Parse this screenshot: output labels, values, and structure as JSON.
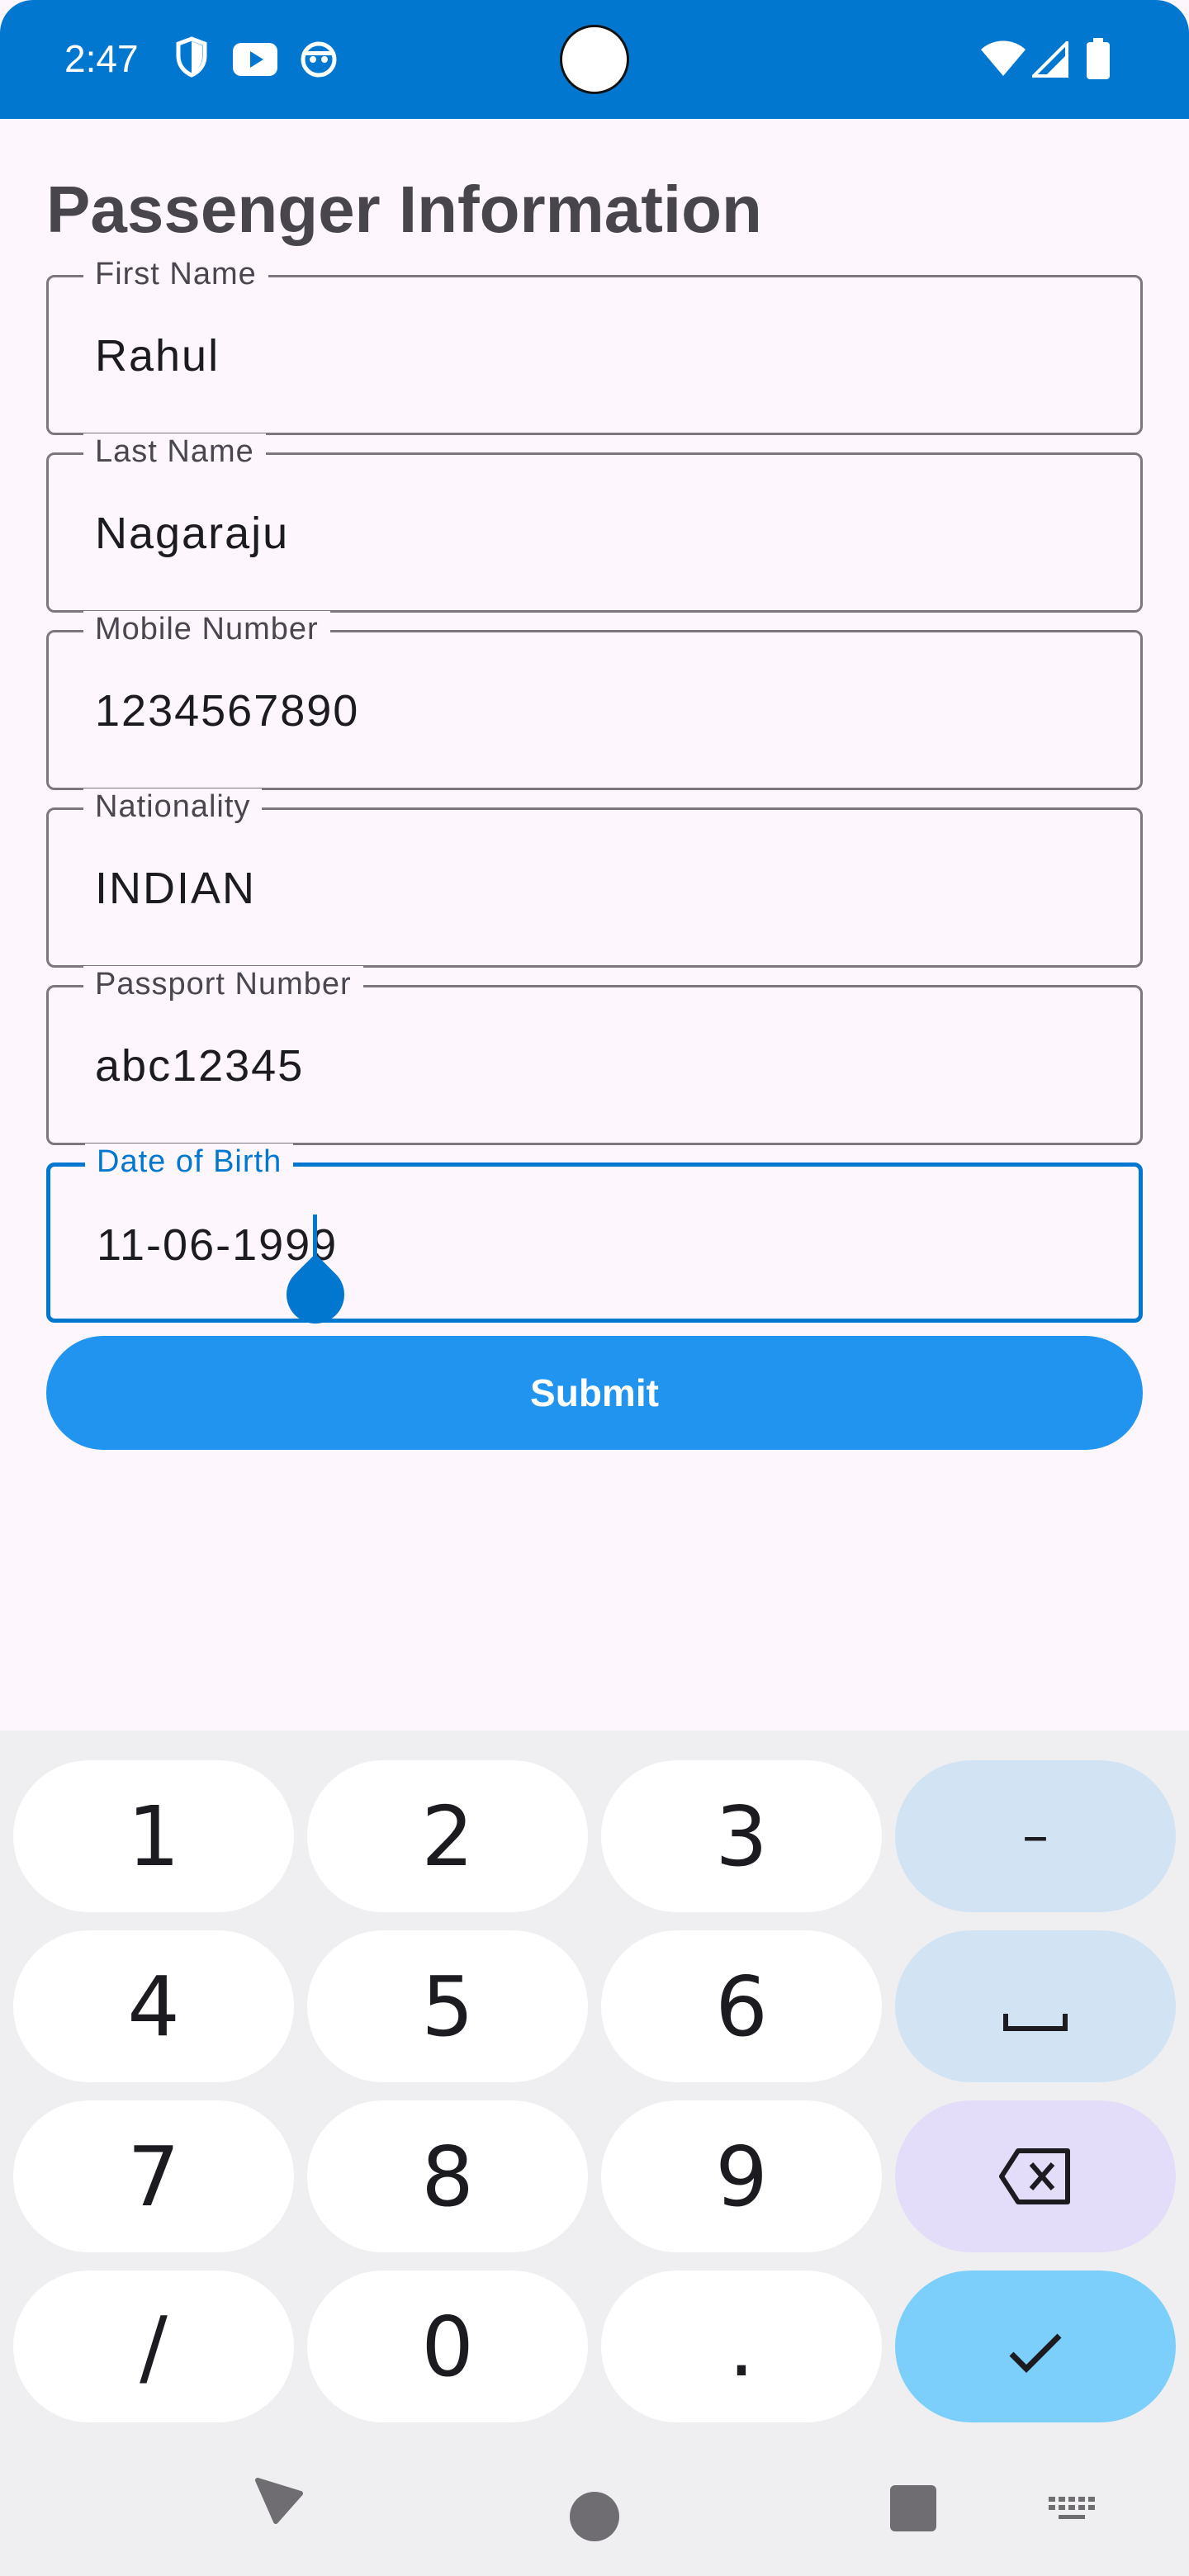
{
  "status_bar": {
    "time": "2:47"
  },
  "page": {
    "title": "Passenger Information"
  },
  "form": {
    "fields": [
      {
        "label": "First Name",
        "value": "Rahul"
      },
      {
        "label": "Last Name",
        "value": "Nagaraju"
      },
      {
        "label": "Mobile Number",
        "value": "1234567890"
      },
      {
        "label": "Nationality",
        "value": "INDIAN"
      },
      {
        "label": "Passport Number",
        "value": "abc12345"
      },
      {
        "label": "Date of Birth",
        "value": "11-06-1999",
        "focused": true
      }
    ],
    "submit_label": "Submit"
  },
  "keyboard": {
    "keys": [
      "1",
      "2",
      "3",
      "–",
      "4",
      "5",
      "6",
      "space",
      "7",
      "8",
      "9",
      "backspace",
      "/",
      "0",
      ".",
      "done"
    ],
    "digits": {
      "k1": "1",
      "k2": "2",
      "k3": "3",
      "k4": "4",
      "k5": "5",
      "k6": "6",
      "k7": "7",
      "k8": "8",
      "k9": "9",
      "k0": "0",
      "slash": "/",
      "dot": ".",
      "dash": "–"
    }
  },
  "icons": {
    "status": [
      "shield-icon",
      "youtube-icon",
      "android-icon",
      "wifi-icon",
      "signal-icon",
      "battery-icon"
    ],
    "nav": [
      "back-icon",
      "home-icon",
      "recents-icon",
      "keyboard-icon"
    ]
  },
  "colors": {
    "accent": "#0277cf",
    "submit": "#2194f0",
    "background": "#fdf6fd",
    "keyboard_bg": "#efeff1",
    "enter_key": "#7bcffa"
  }
}
